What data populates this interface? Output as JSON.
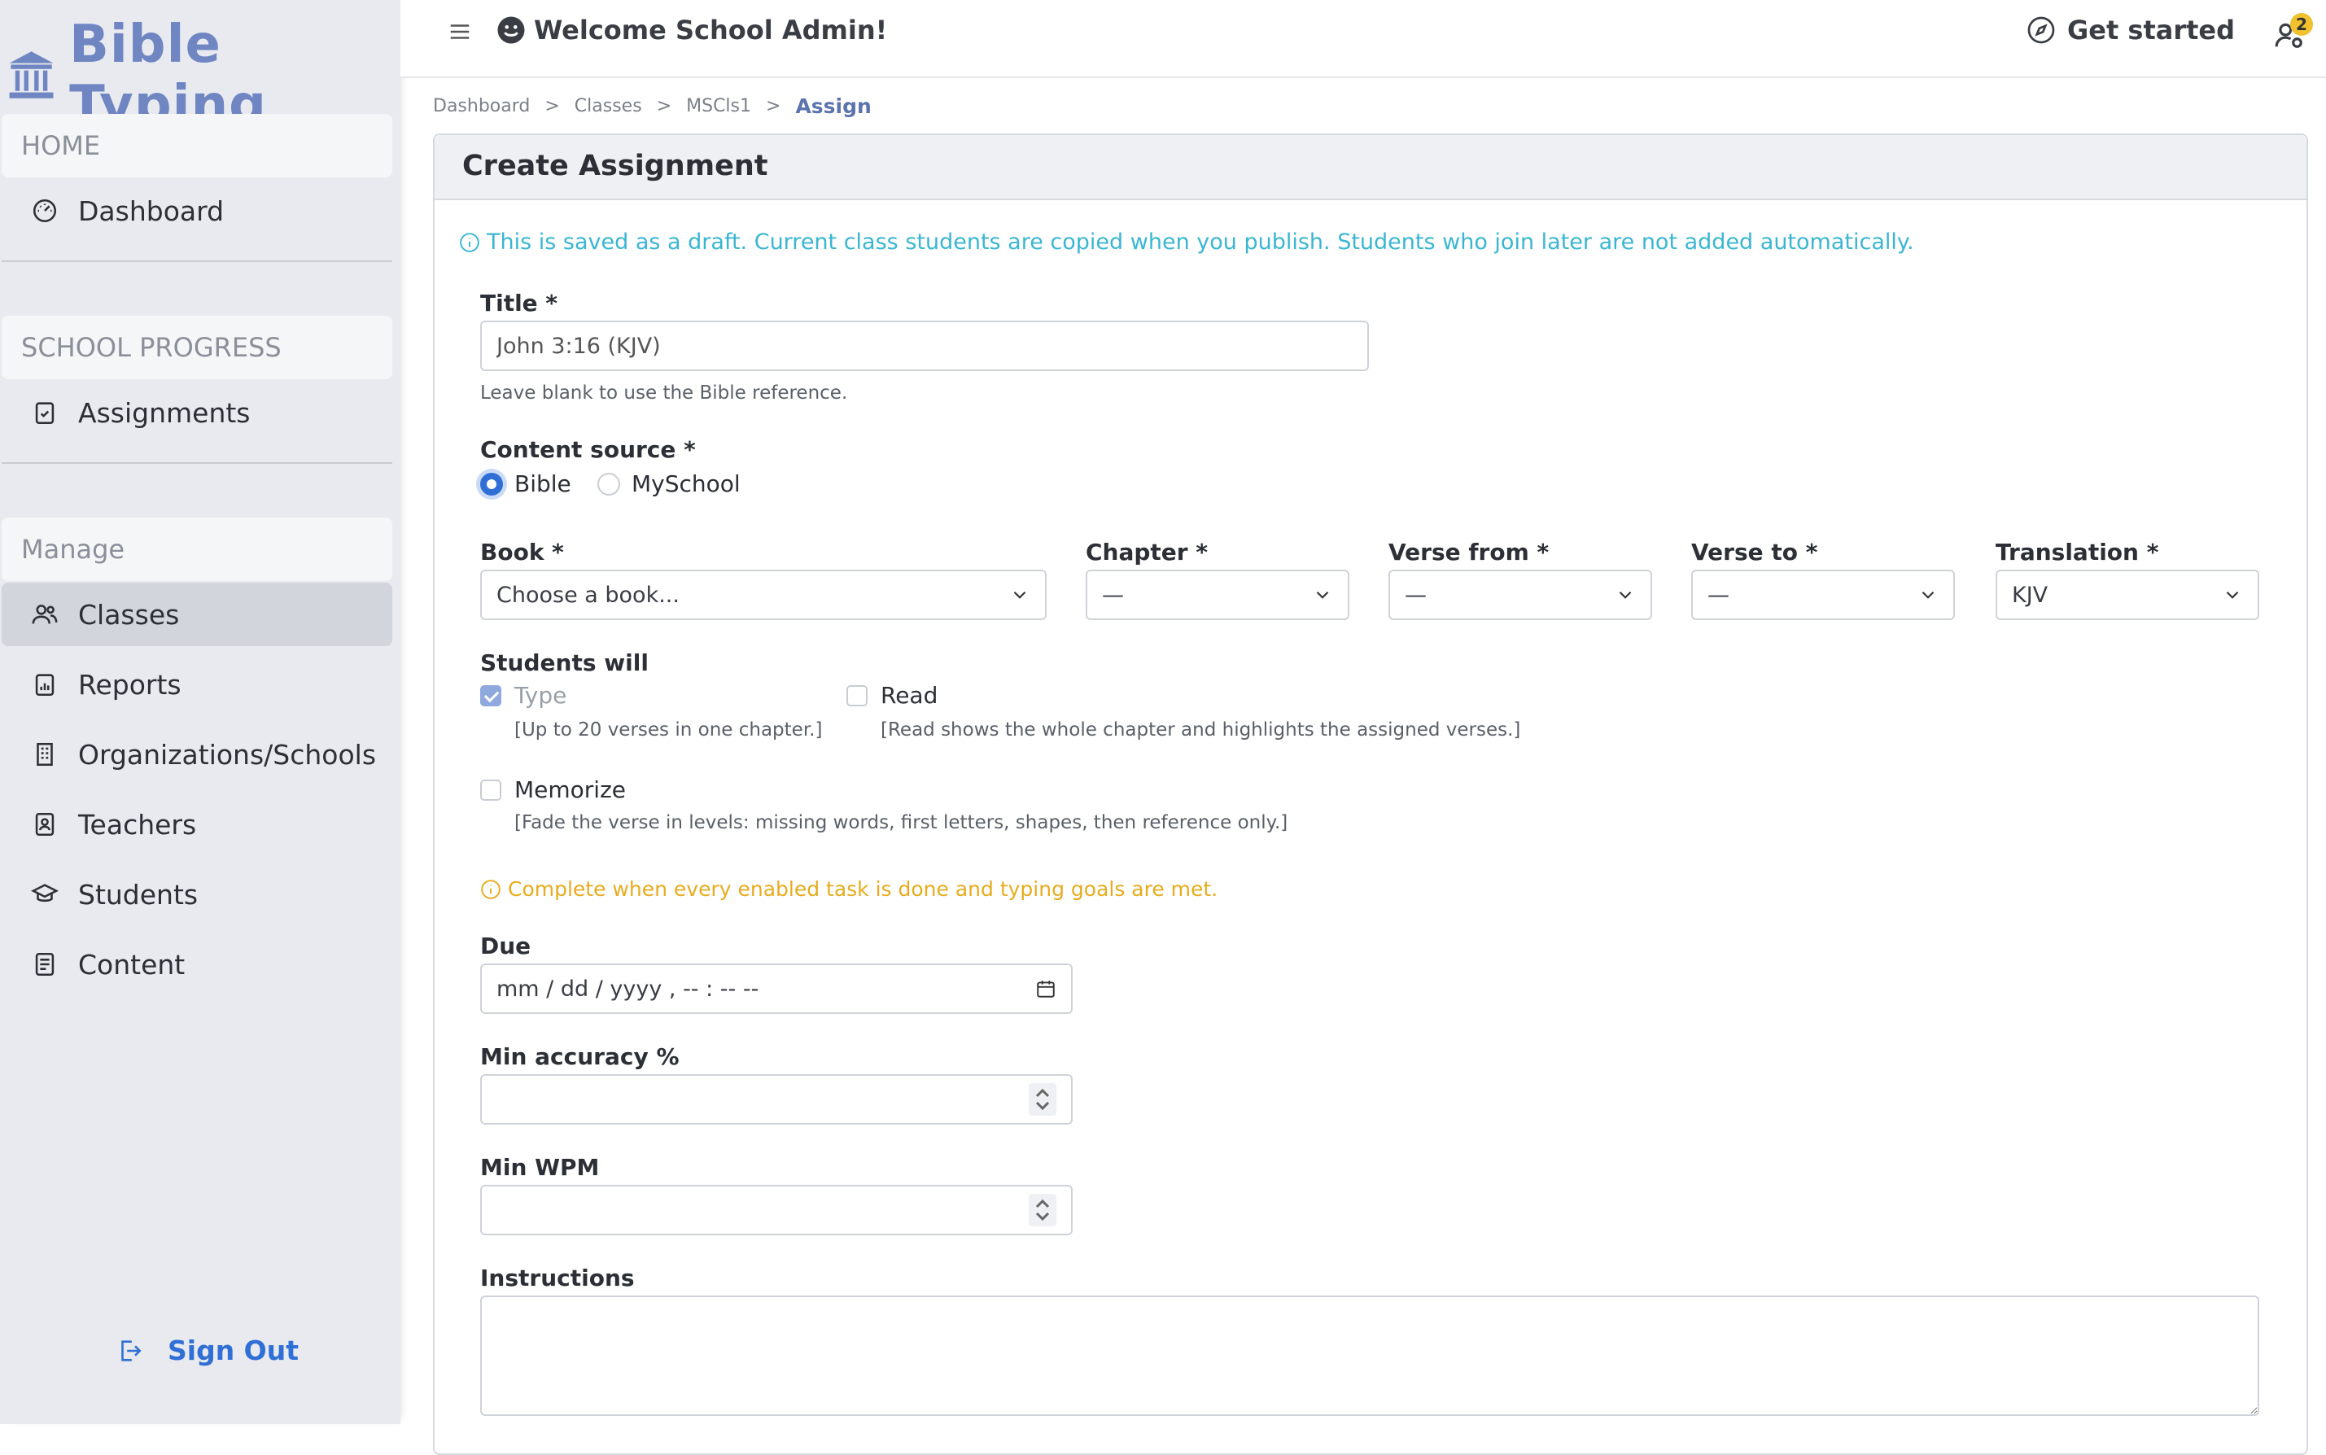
{
  "brand": {
    "name": "Bible Typing"
  },
  "sidebar": {
    "sections": [
      {
        "header": "HOME",
        "items": [
          {
            "label": "Dashboard",
            "icon": "gauge-icon"
          }
        ]
      },
      {
        "header": "SCHOOL PROGRESS",
        "items": [
          {
            "label": "Assignments",
            "icon": "clipboard-check-icon"
          }
        ]
      },
      {
        "header": "Manage",
        "items": [
          {
            "label": "Classes",
            "icon": "users-icon",
            "active": true
          },
          {
            "label": "Reports",
            "icon": "report-icon"
          },
          {
            "label": "Organizations/Schools",
            "icon": "building-icon"
          },
          {
            "label": "Teachers",
            "icon": "id-badge-icon"
          },
          {
            "label": "Students",
            "icon": "graduation-cap-icon"
          },
          {
            "label": "Content",
            "icon": "document-icon"
          }
        ]
      }
    ],
    "sign_out": "Sign Out"
  },
  "topbar": {
    "welcome": "Welcome School Admin!",
    "get_started": "Get started",
    "notification_count": "2"
  },
  "breadcrumb": [
    "Dashboard",
    "Classes",
    "MSCls1"
  ],
  "breadcrumb_current": "Assign",
  "breadcrumb_separator": ">",
  "form": {
    "title": "Create Assignment",
    "draft_notice": "This is saved as a draft. Current class students are copied when you publish. Students who join later are not added automatically.",
    "title_label": "Title *",
    "title_value": "John 3:16 (KJV)",
    "title_help": "Leave blank to use the Bible reference.",
    "content_source_label": "Content source *",
    "content_source_options": [
      "Bible",
      "MySchool"
    ],
    "content_source_selected": "Bible",
    "book_label": "Book *",
    "book_value": "Choose a book...",
    "chapter_label": "Chapter *",
    "chapter_value": "—",
    "verse_from_label": "Verse from *",
    "verse_from_value": "—",
    "verse_to_label": "Verse to *",
    "verse_to_value": "—",
    "translation_label": "Translation *",
    "translation_value": "KJV",
    "students_will_label": "Students will",
    "tasks": [
      {
        "label": "Type",
        "checked": true,
        "help": "[Up to 20 verses in one chapter.]"
      },
      {
        "label": "Read",
        "checked": false,
        "help": "[Read shows the whole chapter and highlights the assigned verses.]"
      },
      {
        "label": "Memorize",
        "checked": false,
        "help": "[Fade the verse in levels: missing words, first letters, shapes, then reference only.]"
      }
    ],
    "completion_notice": "Complete when every enabled task is done and typing goals are met.",
    "due_label": "Due",
    "due_placeholder": "mm / dd / yyyy ,  -- : --   --",
    "min_accuracy_label": "Min accuracy %",
    "min_wpm_label": "Min WPM",
    "instructions_label": "Instructions"
  },
  "colors": {
    "accent": "#2f6fd6",
    "brand": "#6f86c3",
    "info": "#3ab6d3",
    "warning": "#e7ac1e"
  }
}
